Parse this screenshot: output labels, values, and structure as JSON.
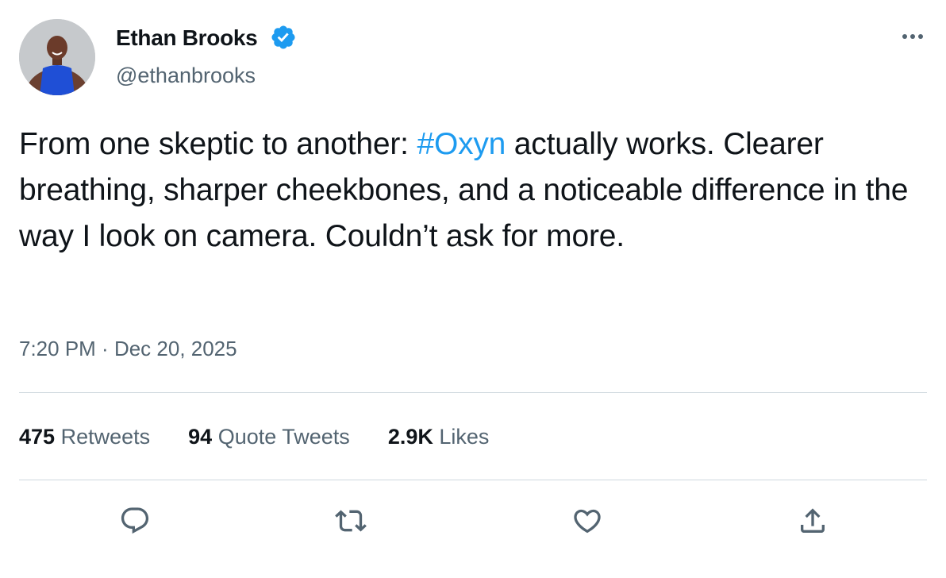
{
  "author": {
    "display_name": "Ethan Brooks",
    "handle": "@ethanbrooks",
    "verified": true,
    "avatar_icon": "profile-photo"
  },
  "tweet": {
    "text_before": "From one skeptic to another: ",
    "hashtag": "#Oxyn",
    "text_after": " actually works. Clearer breathing, sharper cheekbones, and a noticeable difference in the way I look on camera. Couldn’t ask for more.",
    "time": "7:20 PM",
    "separator": " · ",
    "date": "Dec 20, 2025"
  },
  "stats": {
    "retweets_count": "475",
    "retweets_label": "Retweets",
    "quotes_count": "94",
    "quotes_label": "Quote Tweets",
    "likes_count": "2.9K",
    "likes_label": "Likes"
  },
  "actions": [
    "reply-icon",
    "retweet-icon",
    "like-icon",
    "share-icon"
  ],
  "colors": {
    "text": "#0f1419",
    "secondary": "#536471",
    "accent": "#1d9bf0",
    "divider": "#cfd9de"
  }
}
